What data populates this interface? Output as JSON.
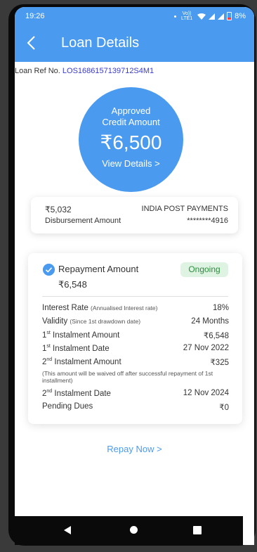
{
  "status": {
    "time": "19:26",
    "network_text": "Vo)) LTE1",
    "battery": "8%"
  },
  "header": {
    "title": "Loan Details"
  },
  "loan_ref": {
    "label": "Loan Ref No.",
    "value": "LOS1686157139712S4M1"
  },
  "credit": {
    "line1": "Approved",
    "line2": "Credit Amount",
    "amount": "₹6,500",
    "link": "View Details >"
  },
  "disbursement": {
    "amount": "₹5,032",
    "label": "Disbursement Amount",
    "bank": "INDIA POST PAYMENTS",
    "account": "********4916"
  },
  "repayment": {
    "label": "Repayment Amount",
    "amount": "₹6,548",
    "status": "Ongoing",
    "details": {
      "interest_rate_label": "Interest Rate",
      "interest_rate_note": "(Annualised Interest rate)",
      "interest_rate_value": "18%",
      "validity_label": "Validity",
      "validity_note": "(Since 1st drawdown date)",
      "validity_value": "24 Months",
      "inst1_amount_num": "1",
      "inst1_amount_sup": "st",
      "inst1_amount_label": " Instalment Amount",
      "inst1_amount_value": "₹6,548",
      "inst1_date_num": "1",
      "inst1_date_sup": "st",
      "inst1_date_label": " Instalment Date",
      "inst1_date_value": "27 Nov 2022",
      "inst2_amount_num": "2",
      "inst2_amount_sup": "nd",
      "inst2_amount_label": " Instalment Amount",
      "inst2_amount_value": "₹325",
      "waiver_note": "(This amount will be waived off after successful repayment of 1st installment)",
      "inst2_date_num": "2",
      "inst2_date_sup": "nd",
      "inst2_date_label": " Instalment Date",
      "inst2_date_value": "12 Nov 2024",
      "pending_label": "Pending Dues",
      "pending_value": "₹0"
    }
  },
  "action": {
    "repay": "Repay Now >"
  },
  "colors": {
    "primary": "#4a9bf0",
    "success_bg": "#dff3e3",
    "success_text": "#2e8b3e",
    "link": "#3b3bd0"
  },
  "icons": [
    "back-arrow-icon",
    "check-circle-icon",
    "signal-icon",
    "wifi-icon",
    "battery-icon",
    "nav-back-icon",
    "nav-home-icon",
    "nav-recents-icon"
  ]
}
